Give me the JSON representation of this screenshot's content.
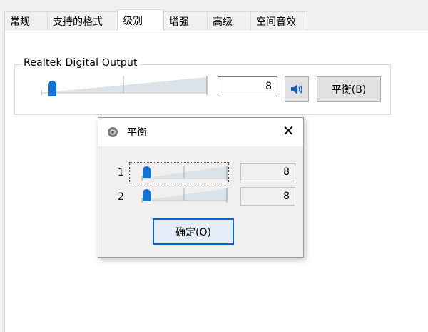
{
  "tabs": [
    {
      "label": "常规"
    },
    {
      "label": "支持的格式"
    },
    {
      "label": "级别"
    },
    {
      "label": "增强"
    },
    {
      "label": "高级"
    },
    {
      "label": "空间音效"
    }
  ],
  "active_tab": "级别",
  "device": {
    "name": "Realtek Digital Output",
    "volume_value": "8",
    "volume_level_percent": 8,
    "mute_icon": "speaker-icon",
    "balance_button": "平衡(B)"
  },
  "balance_dialog": {
    "title": "平衡",
    "close_glyph": "✕",
    "channels": [
      {
        "label": "1",
        "value": "8",
        "level_percent": 8
      },
      {
        "label": "2",
        "value": "8",
        "level_percent": 8
      }
    ],
    "ok_button": "确定(O)"
  },
  "colors": {
    "accent": "#1474d4",
    "wedge": "#dbe2e8"
  }
}
